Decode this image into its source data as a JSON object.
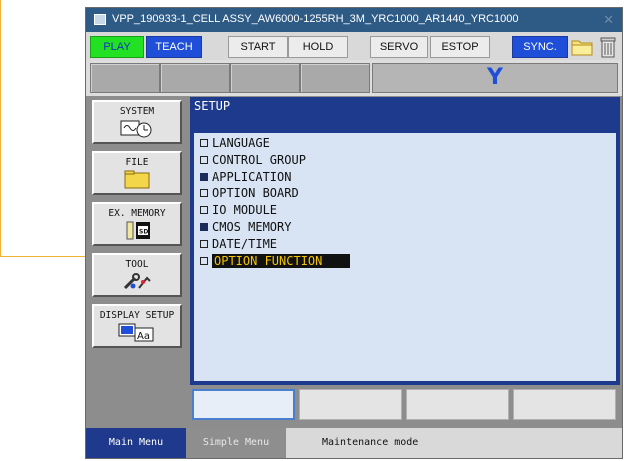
{
  "window": {
    "title": "VPP_190933-1_CELL ASSY_AW6000-1255RH_3M_YRC1000_AR1440_YRC1000",
    "close_icon": "close-icon"
  },
  "toolbar": {
    "play": "PLAY",
    "teach": "TEACH",
    "start": "START",
    "hold": "HOLD",
    "servo_on": "SERVO ON",
    "estop": "ESTOP",
    "sync": "SYNC."
  },
  "status": {
    "coord": "Y"
  },
  "sidebar": {
    "items": [
      {
        "label": "SYSTEM",
        "icon": "system-clock-icon"
      },
      {
        "label": "FILE",
        "icon": "folder-icon"
      },
      {
        "label": "EX. MEMORY",
        "icon": "sd-card-icon"
      },
      {
        "label": "TOOL",
        "icon": "tool-icon"
      },
      {
        "label": "DISPLAY SETUP",
        "icon": "display-aa-icon"
      }
    ]
  },
  "panel": {
    "title": "SETUP",
    "items": [
      {
        "label": "LANGUAGE",
        "filled": false
      },
      {
        "label": "CONTROL GROUP",
        "filled": false
      },
      {
        "label": "APPLICATION",
        "filled": true
      },
      {
        "label": "OPTION BOARD",
        "filled": false
      },
      {
        "label": "IO MODULE",
        "filled": false
      },
      {
        "label": "CMOS MEMORY",
        "filled": true
      },
      {
        "label": "DATE/TIME",
        "filled": false
      },
      {
        "label": "OPTION FUNCTION",
        "filled": false,
        "selected": true
      }
    ]
  },
  "bottom": {
    "main_menu": "Main Menu",
    "simple_menu": "Simple Menu",
    "mode": "Maintenance mode"
  },
  "colors": {
    "accent": "#1e3a8c",
    "play": "#22e022",
    "teach": "#1f4fd8",
    "highlight_text": "#f4c400",
    "annotation": "#f2b233"
  }
}
